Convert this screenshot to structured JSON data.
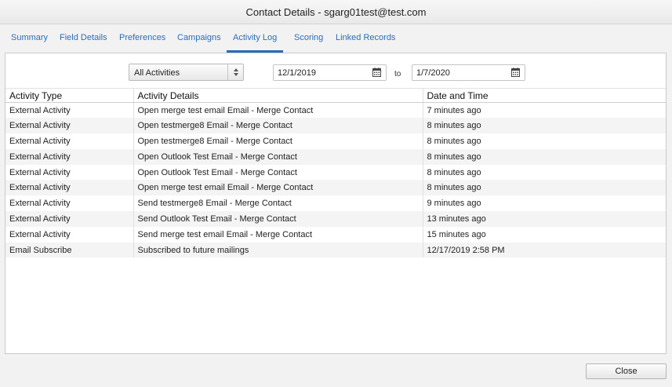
{
  "window": {
    "title": "Contact Details - sgarg01test@test.com"
  },
  "tabs": [
    {
      "label": "Summary"
    },
    {
      "label": "Field Details"
    },
    {
      "label": "Preferences"
    },
    {
      "label": "Campaigns"
    },
    {
      "label": "Activity Log",
      "active": true
    },
    {
      "label": "Scoring"
    },
    {
      "label": "Linked Records"
    }
  ],
  "filters": {
    "activity_type": "All Activities",
    "from_date": "12/1/2019",
    "to_label": "to",
    "to_date": "1/7/2020"
  },
  "table": {
    "columns": [
      "Activity Type",
      "Activity Details",
      "Date and Time"
    ],
    "rows": [
      [
        "External Activity",
        "Open merge test email Email - Merge Contact",
        "7 minutes ago"
      ],
      [
        "External Activity",
        "Open testmerge8 Email - Merge Contact",
        "8 minutes ago"
      ],
      [
        "External Activity",
        "Open testmerge8 Email - Merge Contact",
        "8 minutes ago"
      ],
      [
        "External Activity",
        "Open Outlook Test Email - Merge Contact",
        "8 minutes ago"
      ],
      [
        "External Activity",
        "Open Outlook Test Email - Merge Contact",
        "8 minutes ago"
      ],
      [
        "External Activity",
        "Open merge test email Email - Merge Contact",
        "8 minutes ago"
      ],
      [
        "External Activity",
        "Send testmerge8 Email - Merge Contact",
        "9 minutes ago"
      ],
      [
        "External Activity",
        "Send Outlook Test Email - Merge Contact",
        "13 minutes ago"
      ],
      [
        "External Activity",
        "Send merge test email Email - Merge Contact",
        "15 minutes ago"
      ],
      [
        "Email Subscribe",
        "Subscribed to future mailings",
        "12/17/2019 2:58 PM"
      ]
    ]
  },
  "footer": {
    "close_label": "Close"
  },
  "colors": {
    "tab_link": "#2a6ebb",
    "row_alt": "#f4f4f4",
    "border": "#c9c9c9"
  },
  "icons": {
    "date_picker": "calendar-icon",
    "select": "up-down-arrows-icon"
  }
}
